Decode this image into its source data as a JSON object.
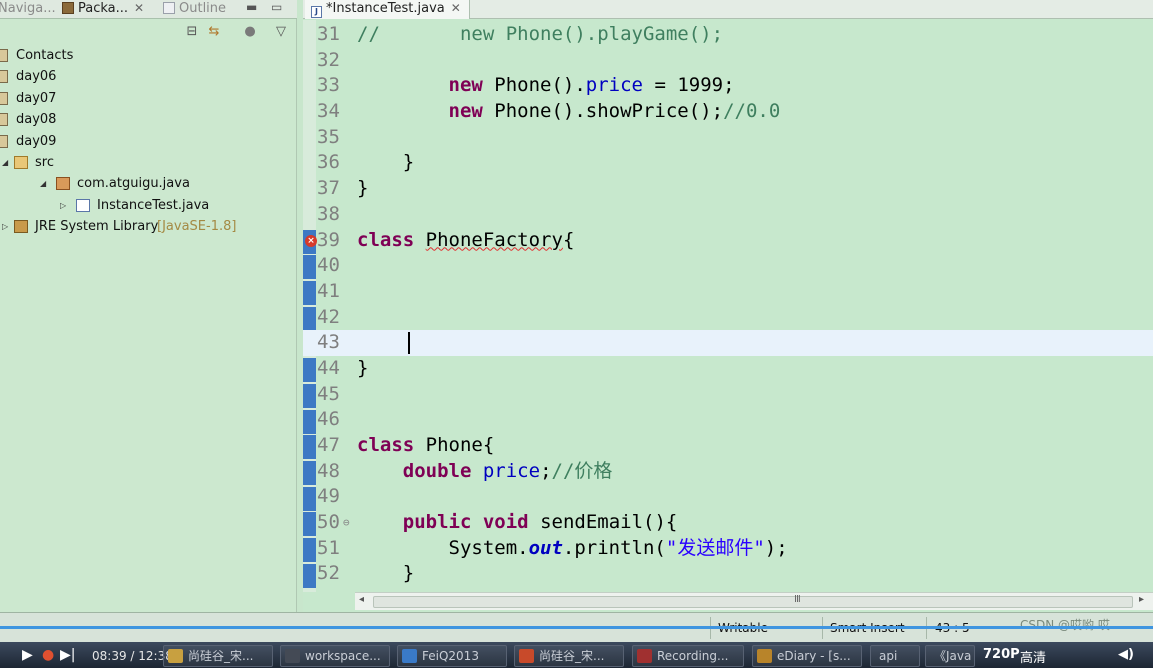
{
  "left_panel": {
    "tabs": [
      {
        "label": "Naviga...",
        "active": false
      },
      {
        "label": "Packa...",
        "active": true
      },
      {
        "label": "Outline",
        "active": false
      }
    ],
    "tree": [
      {
        "label": "Contacts",
        "level": 0
      },
      {
        "label": "day06",
        "level": 0
      },
      {
        "label": "day07",
        "level": 0
      },
      {
        "label": "day08",
        "level": 0
      },
      {
        "label": "day09",
        "level": 0
      },
      {
        "label": "src",
        "level": 0,
        "expanded": true
      },
      {
        "label": "com.atguigu.java",
        "level": 1,
        "expanded": true
      },
      {
        "label": "InstanceTest.java",
        "level": 2
      },
      {
        "label": "JRE System Library",
        "decoration": "[JavaSE-1.8]",
        "level": 0
      }
    ]
  },
  "editor": {
    "tab_label": "*InstanceTest.java",
    "current_line": "43",
    "error_line": "39",
    "lines": [
      {
        "num": "31",
        "code": [
          {
            "t": "//       new Phone().playGame();",
            "c": "cmt"
          }
        ]
      },
      {
        "num": "32",
        "code": []
      },
      {
        "num": "33",
        "code": [
          {
            "t": "        ",
            "c": ""
          },
          {
            "t": "new",
            "c": "kw"
          },
          {
            "t": " Phone().",
            "c": ""
          },
          {
            "t": "price",
            "c": "fld"
          },
          {
            "t": " = 1999;",
            "c": ""
          }
        ]
      },
      {
        "num": "34",
        "code": [
          {
            "t": "        ",
            "c": ""
          },
          {
            "t": "new",
            "c": "kw"
          },
          {
            "t": " Phone().showPrice();",
            "c": ""
          },
          {
            "t": "//0.0",
            "c": "cmt"
          }
        ]
      },
      {
        "num": "35",
        "code": []
      },
      {
        "num": "36",
        "code": [
          {
            "t": "    }",
            "c": ""
          }
        ]
      },
      {
        "num": "37",
        "code": [
          {
            "t": "}",
            "c": ""
          }
        ]
      },
      {
        "num": "38",
        "code": []
      },
      {
        "num": "39",
        "code": [
          {
            "t": "class",
            "c": "kw"
          },
          {
            "t": " ",
            "c": ""
          },
          {
            "t": "PhoneFactory",
            "c": "err"
          },
          {
            "t": "{",
            "c": ""
          }
        ]
      },
      {
        "num": "40",
        "code": []
      },
      {
        "num": "41",
        "code": []
      },
      {
        "num": "42",
        "code": []
      },
      {
        "num": "43",
        "code": []
      },
      {
        "num": "44",
        "code": [
          {
            "t": "}",
            "c": ""
          }
        ]
      },
      {
        "num": "45",
        "code": []
      },
      {
        "num": "46",
        "code": []
      },
      {
        "num": "47",
        "code": [
          {
            "t": "class",
            "c": "kw"
          },
          {
            "t": " Phone{",
            "c": ""
          }
        ]
      },
      {
        "num": "48",
        "code": [
          {
            "t": "    ",
            "c": ""
          },
          {
            "t": "double",
            "c": "kw"
          },
          {
            "t": " ",
            "c": ""
          },
          {
            "t": "price",
            "c": "fld"
          },
          {
            "t": ";",
            "c": ""
          },
          {
            "t": "//价格",
            "c": "cmt"
          }
        ]
      },
      {
        "num": "49",
        "code": []
      },
      {
        "num": "50",
        "code": [
          {
            "t": "    ",
            "c": ""
          },
          {
            "t": "public",
            "c": "kw"
          },
          {
            "t": " ",
            "c": ""
          },
          {
            "t": "void",
            "c": "kw"
          },
          {
            "t": " sendEmail(){",
            "c": ""
          }
        ]
      },
      {
        "num": "51",
        "code": [
          {
            "t": "        System.",
            "c": ""
          },
          {
            "t": "out",
            "c": "sfld"
          },
          {
            "t": ".println(",
            "c": ""
          },
          {
            "t": "\"发送邮件\"",
            "c": "str"
          },
          {
            "t": ");",
            "c": ""
          }
        ]
      },
      {
        "num": "52",
        "code": [
          {
            "t": "    }",
            "c": ""
          }
        ]
      }
    ],
    "fold_lines": [
      "39",
      "50"
    ],
    "scroll_grip": "III"
  },
  "status_bar": {
    "writable": "Writable",
    "insert_mode": "Smart Insert",
    "position": "43 : 5"
  },
  "taskbar": {
    "time": "08:39 / 12:38",
    "items": [
      {
        "label": "尚硅谷_宋...",
        "color": "#c8a040"
      },
      {
        "label": "workspace...",
        "color": "#444a55"
      },
      {
        "label": "FeiQ2013",
        "color": "#3a7ac8"
      },
      {
        "label": "尚硅谷_宋...",
        "color": "#c84a2a"
      },
      {
        "label": "Recording...",
        "color": "#a03030"
      },
      {
        "label": "eDiary - [s...",
        "color": "#b8842a"
      },
      {
        "label": "api",
        "color": ""
      },
      {
        "label": "《Java",
        "color": ""
      }
    ],
    "quality": "720P",
    "tray_text": "高清",
    "watermark": "CSDN @哎哟 哎"
  },
  "colors": {
    "keyword": "#7f0055",
    "field": "#0000c0",
    "comment": "#3f7f5f",
    "string": "#2a00ff",
    "editor_bg": "#c7e8cd",
    "current_line_bg": "#e8f2fb",
    "error": "#d63a2a"
  }
}
